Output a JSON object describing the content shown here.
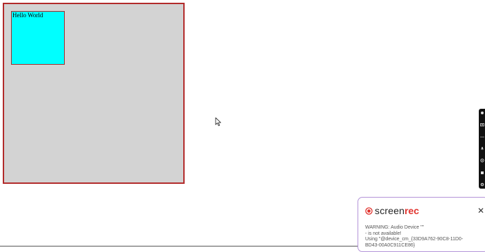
{
  "canvas": {
    "inner_text": "Hello World",
    "colors": {
      "outer_fill": "#d3d3d3",
      "outer_border": "#b22a2a",
      "inner_fill": "#00ffff",
      "inner_border": "#a52a2a"
    }
  },
  "cursor": {
    "icon": "mouse-pointer-icon"
  },
  "side_toolbar": {
    "tools": [
      {
        "icon": "pin-icon"
      },
      {
        "icon": "camera-icon"
      },
      {
        "icon": "dots-icon"
      },
      {
        "icon": "microphone-icon"
      },
      {
        "icon": "webcam-icon"
      },
      {
        "icon": "stop-icon"
      },
      {
        "icon": "settings-icon"
      }
    ]
  },
  "notification": {
    "logo_main": "screen",
    "logo_accent": "rec",
    "logo_icon": "record-icon",
    "close_icon": "close-icon",
    "close_label": "✕",
    "message_lines": [
      "WARNING: Audio Device \"\"",
      " - is not available!",
      "Using \"@device_cm_{33D9A762-90C8-11D0-",
      "BD43-00A0C911CE86}"
    ],
    "colors": {
      "border": "#b393d8",
      "accent": "#e0322c"
    }
  }
}
